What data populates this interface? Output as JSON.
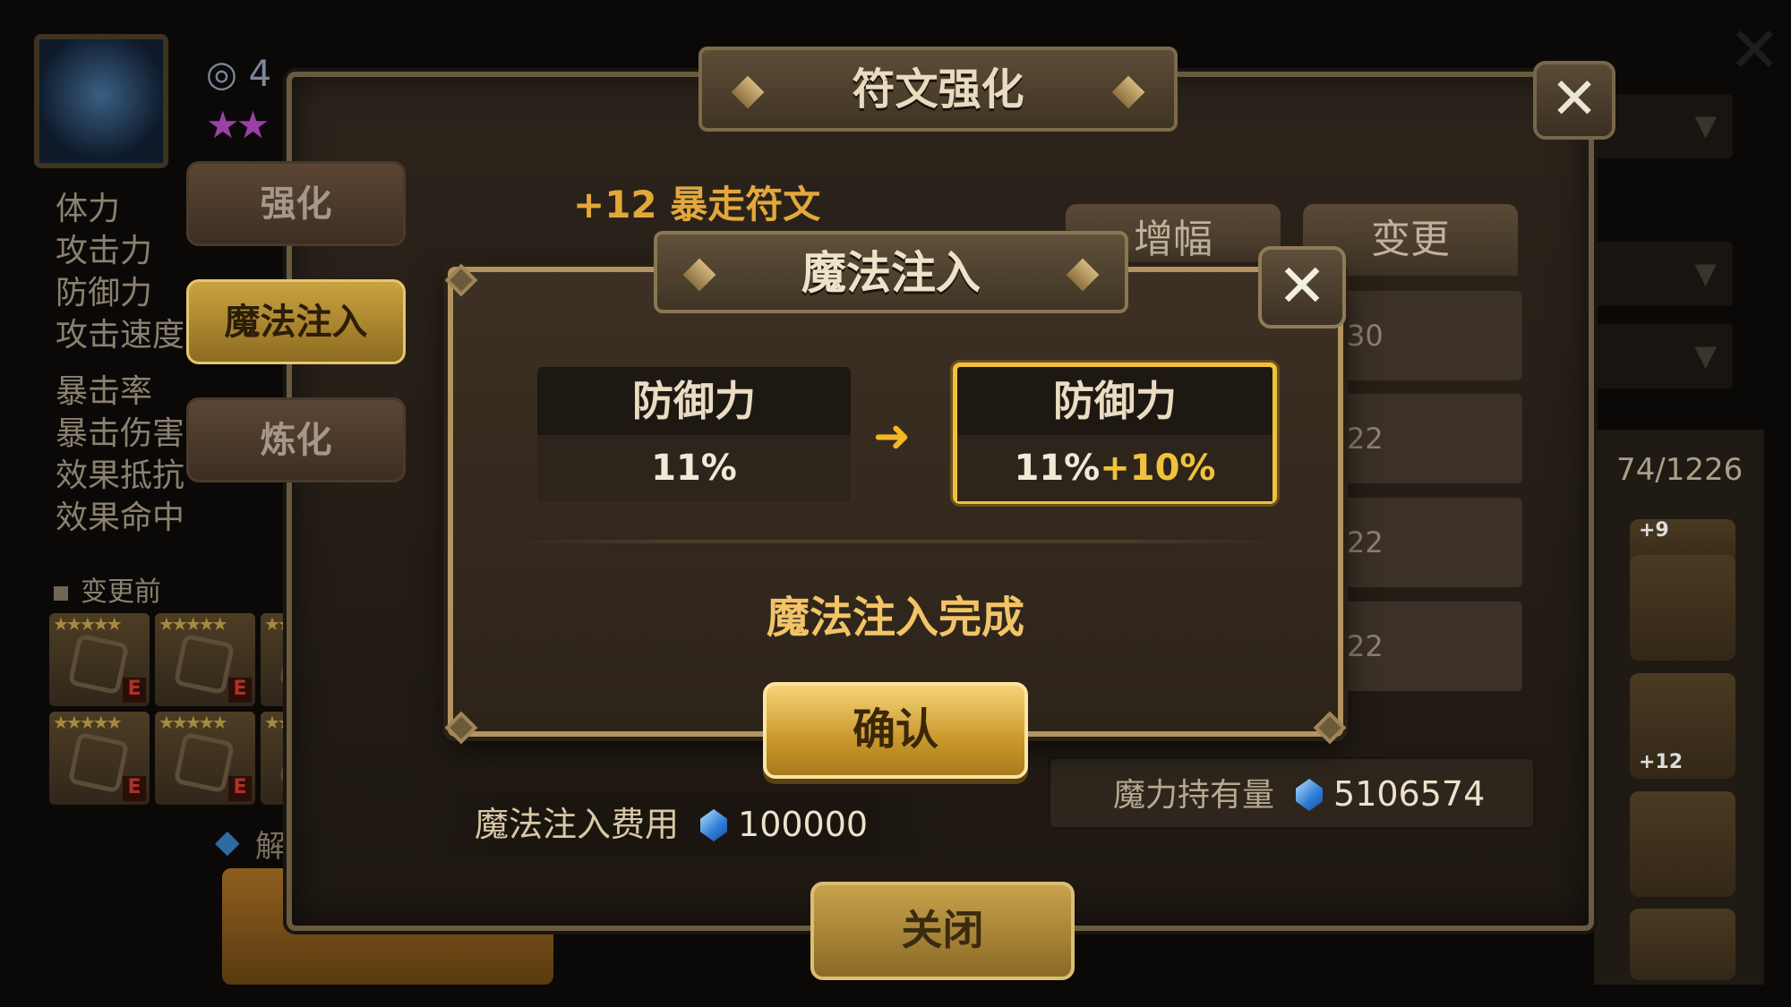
{
  "background": {
    "hero": {
      "level_partial": "4"
    },
    "stats": [
      "体力",
      "攻击力",
      "防御力",
      "攻击速度",
      "暴击率",
      "暴击伤害",
      "效果抵抗",
      "效果命中"
    ],
    "before_change_label": "变更前",
    "left_bottom_text": "解",
    "right_count": "74/1226",
    "right_plus_9": "+9",
    "right_plus_12": "+12"
  },
  "main_dialog": {
    "title": "符文强化",
    "close_glyph": "✕",
    "side_tabs": [
      "强化",
      "魔法注入",
      "炼化"
    ],
    "rune_title": "+12 暴走符文",
    "top_tabs": [
      "增幅",
      "变更"
    ],
    "list_values": [
      "30",
      "22",
      "22",
      "22"
    ],
    "cost_label": "魔法注入费用",
    "cost_value": "100000",
    "mana_label": "魔力持有量",
    "mana_value": "5106574",
    "close_button": "关闭"
  },
  "infuse_dialog": {
    "title": "魔法注入",
    "close_glyph": "✕",
    "before": {
      "stat": "防御力",
      "value": "11%"
    },
    "after": {
      "stat": "防御力",
      "value": "11%",
      "bonus": "+10%"
    },
    "arrow": "➜",
    "message": "魔法注入完成",
    "confirm_button": "确认"
  },
  "colors": {
    "accent_gold": "#f0c23c",
    "title_text": "#e8dbbf",
    "message_text": "#f2c466"
  }
}
